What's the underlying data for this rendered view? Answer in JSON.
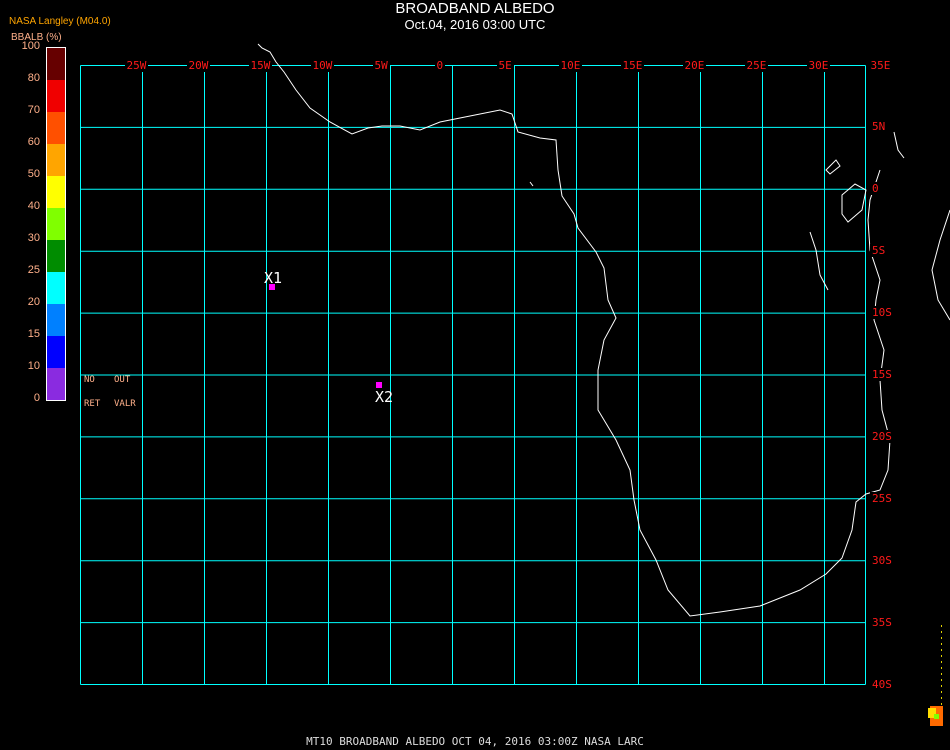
{
  "header": {
    "title": "BROADBAND ALBEDO",
    "subtitle": "Oct.04, 2016 03:00 UTC"
  },
  "legend": {
    "producer": "NASA Langley (M04.0)",
    "unit": "BBALB (%)",
    "labels": [
      "100",
      "80",
      "70",
      "60",
      "50",
      "40",
      "30",
      "25",
      "20",
      "15",
      "10",
      "0"
    ],
    "colors": [
      "#660000",
      "#f00000",
      "#ff5000",
      "#ffa500",
      "#ffff00",
      "#80ff00",
      "#008c00",
      "#00ffff",
      "#0080ff",
      "#0000ff",
      "#8a2be0"
    ],
    "no_ret": [
      "NO",
      "RET"
    ],
    "out_valr": [
      "OUT",
      "VALR"
    ]
  },
  "map": {
    "grid_color": "#00ffff",
    "lon_labels": [
      "25W",
      "20W",
      "15W",
      "10W",
      "5W",
      "0",
      "5E",
      "10E",
      "15E",
      "20E",
      "25E",
      "30E",
      "35E"
    ],
    "lat_labels": [
      "5N",
      "0",
      "5S",
      "10S",
      "15S",
      "20S",
      "25S",
      "30S",
      "35S",
      "40S"
    ],
    "markers": [
      {
        "label": "X1",
        "color": "#ff00ff"
      },
      {
        "label": "X2",
        "color": "#ff00ff"
      }
    ]
  },
  "footer": {
    "text": "MT10  BROADBAND ALBEDO   OCT 04, 2016 03:00Z   NASA LARC"
  }
}
